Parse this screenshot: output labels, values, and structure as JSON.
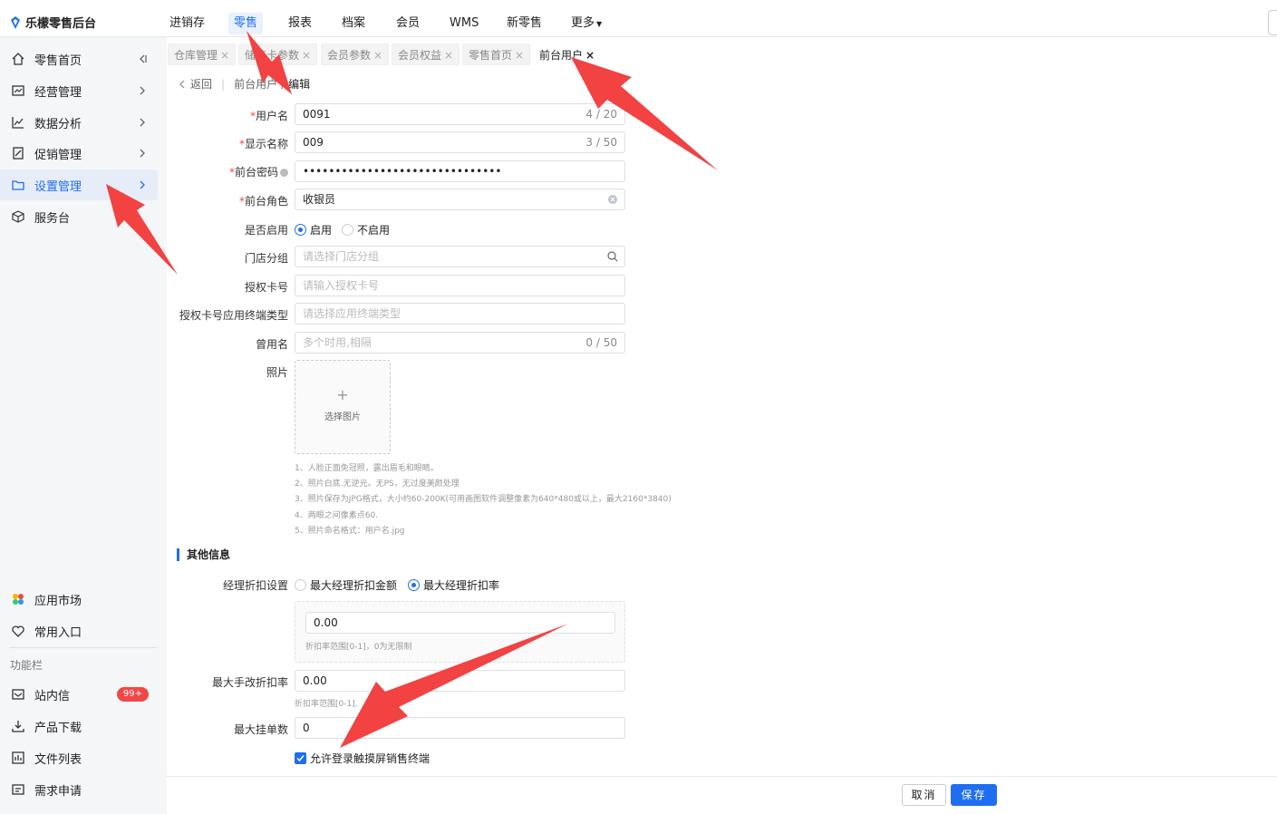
{
  "app": {
    "title": "乐檬零售后台"
  },
  "topnav": [
    "进销存",
    "零售",
    "报表",
    "档案",
    "会员",
    "WMS",
    "新零售",
    "更多"
  ],
  "sidebar": {
    "items": [
      {
        "label": "零售首页",
        "icon": "home-icon"
      },
      {
        "label": "经营管理",
        "icon": "chart-board-icon"
      },
      {
        "label": "数据分析",
        "icon": "line-chart-icon"
      },
      {
        "label": "促销管理",
        "icon": "promo-icon"
      },
      {
        "label": "设置管理",
        "icon": "folder-icon"
      },
      {
        "label": "服务台",
        "icon": "cube-icon"
      }
    ],
    "bottom": [
      {
        "label": "应用市场",
        "icon": "app-market-icon"
      },
      {
        "label": "常用入口",
        "icon": "heart-icon"
      }
    ],
    "section_title": "功能栏",
    "tools": [
      {
        "label": "站内信",
        "icon": "mail-icon",
        "badge": "99+"
      },
      {
        "label": "产品下载",
        "icon": "download-icon"
      },
      {
        "label": "文件列表",
        "icon": "file-list-icon"
      },
      {
        "label": "需求申请",
        "icon": "request-icon"
      }
    ],
    "active_color": "#1f6ef0"
  },
  "tabs": [
    {
      "label": "仓库管理",
      "close": "×"
    },
    {
      "label": "储值卡参数",
      "close": "×"
    },
    {
      "label": "会员参数",
      "close": "×"
    },
    {
      "label": "会员权益",
      "close": "×"
    },
    {
      "label": "零售首页",
      "close": "×"
    },
    {
      "label": "前台用户",
      "close": "×"
    }
  ],
  "breadcrumb": {
    "back": "返回",
    "parent": "前台用户",
    "current": "编辑"
  },
  "form": {
    "username": {
      "label": "用户名",
      "value": "0091",
      "count": "4 / 20"
    },
    "display_name": {
      "label": "显示名称",
      "value": "009",
      "count": "3 / 50"
    },
    "password": {
      "label": "前台密码",
      "value": "•••••••••••••••••••••••••••••••"
    },
    "role": {
      "label": "前台角色",
      "value": "收银员"
    },
    "enabled": {
      "label": "是否启用",
      "options": [
        "启用",
        "不启用"
      ],
      "selected": "启用"
    },
    "store_group": {
      "label": "门店分组",
      "placeholder": "请选择门店分组"
    },
    "auth_card": {
      "label": "授权卡号",
      "placeholder": "请输入授权卡号"
    },
    "auth_terminal": {
      "label": "授权卡号应用终端类型",
      "placeholder": "请选择应用终端类型"
    },
    "former_name": {
      "label": "曾用名",
      "placeholder": "多个时用,相隔",
      "count": "0 / 50"
    },
    "photo": {
      "label": "照片",
      "upload_text": "选择图片",
      "plus": "+"
    },
    "photo_notes": [
      "1、人脸正面免冠照，露出眉毛和眼睛。",
      "2、照片白底.无逆光。无PS，无过度美颜处理",
      "3、照片保存为JPG格式，大小约60-200K(可用画图软件调整像素为640*480或以上，最大2160*3840)",
      "4、两眼之间像素点60.",
      "5、照片命名格式：用户名.jpg"
    ]
  },
  "other": {
    "title": "其他信息",
    "discount_setting": {
      "label": "经理折扣设置",
      "options": [
        "最大经理折扣金额",
        "最大经理折扣率"
      ],
      "selected": "最大经理折扣率"
    },
    "discount_value": "0.00",
    "discount_hint": "折扣率范围[0-1]，0为无限制",
    "max_manual": {
      "label": "最大手改折扣率",
      "value": "0.00",
      "hint": "折扣率范围[0-1],"
    },
    "max_pending": {
      "label": "最大挂单数",
      "value": "0"
    },
    "allow_touch": {
      "label": "允许登录触摸屏销售终端",
      "checked": true
    }
  },
  "footer": {
    "cancel": "取消",
    "save": "保存"
  },
  "colors": {
    "primary": "#1f6ef0",
    "annotation_arrow": "#f24242"
  }
}
